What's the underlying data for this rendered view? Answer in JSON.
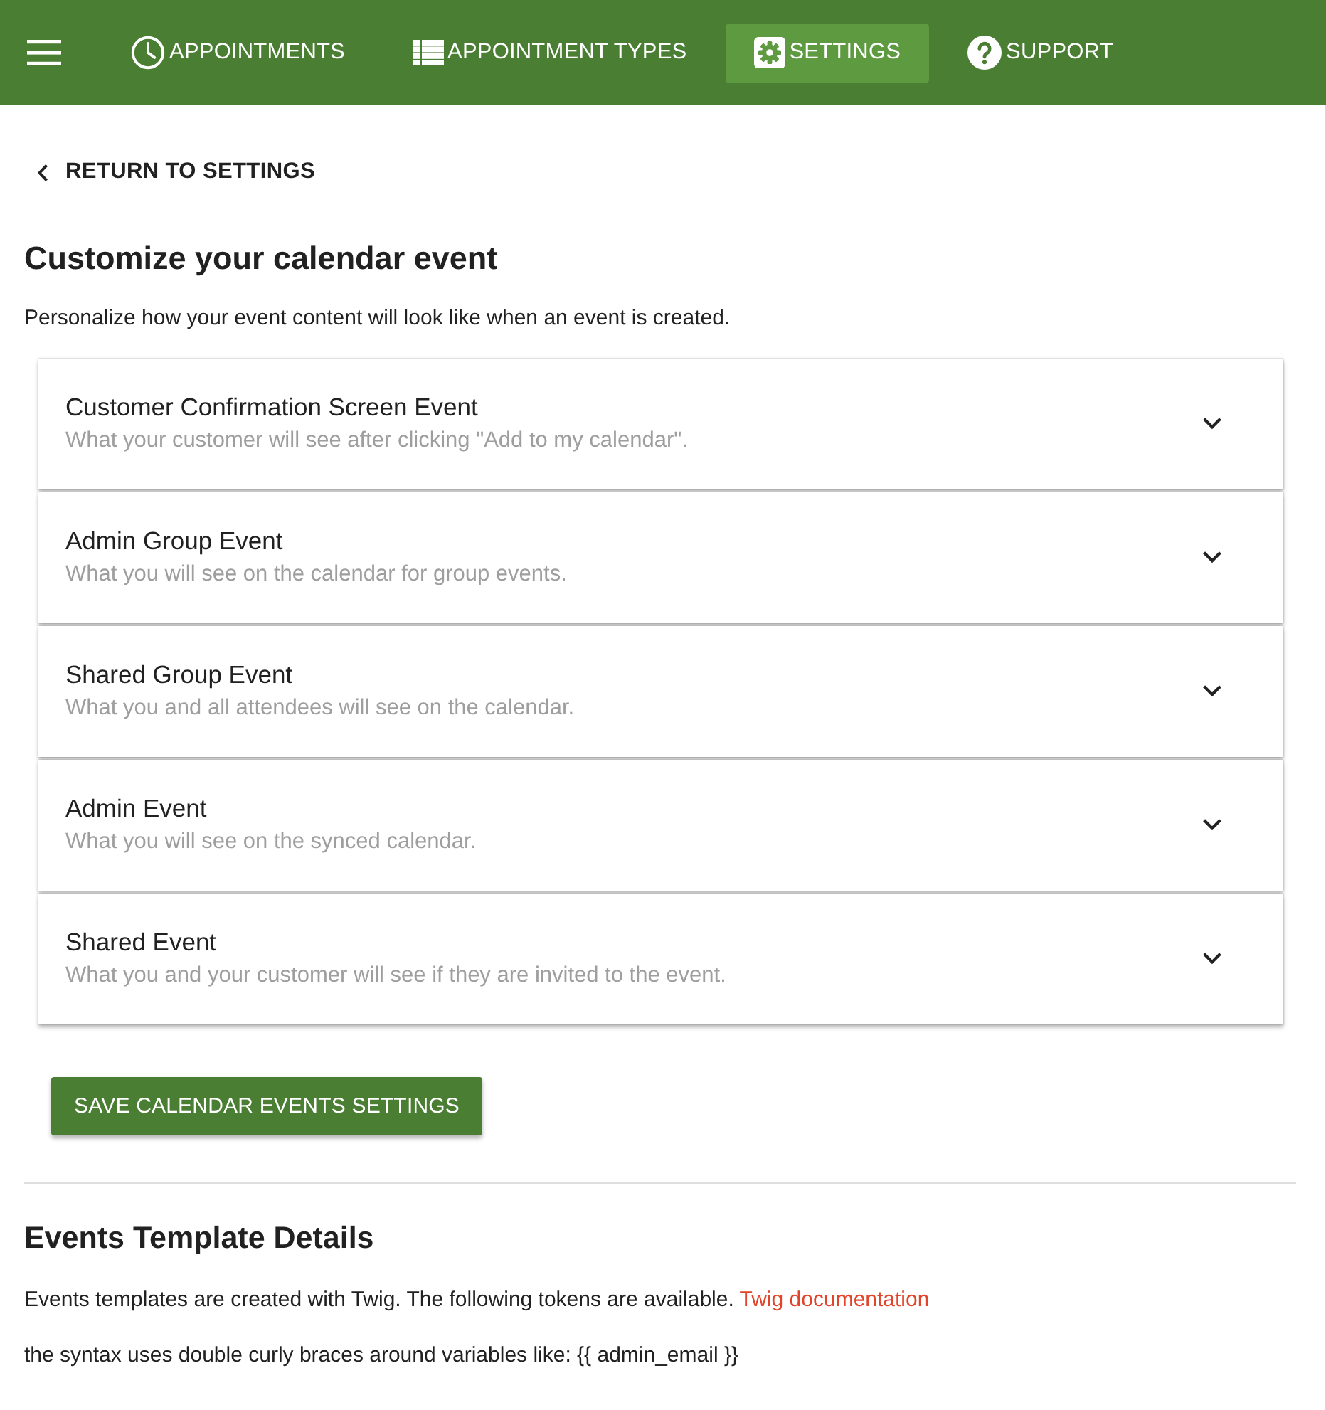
{
  "nav": {
    "tabs": [
      {
        "kind": "clock",
        "label": "APPOINTMENTS",
        "selected": false
      },
      {
        "kind": "list",
        "label": "APPOINTMENT TYPES",
        "selected": false
      },
      {
        "kind": "gear",
        "label": "SETTINGS",
        "selected": true
      },
      {
        "kind": "help",
        "label": "SUPPORT",
        "selected": false
      }
    ]
  },
  "back_link": "RETURN TO SETTINGS",
  "heading": "Customize your calendar event",
  "intro": "Personalize how your event content will look like when an event is created.",
  "panels": [
    {
      "title": "Customer Confirmation Screen Event",
      "subtitle": "What your customer will see after clicking \"Add to my calendar\".",
      "expanded": false
    },
    {
      "title": "Admin Group Event",
      "subtitle": "What you will see on the calendar for group events.",
      "expanded": false
    },
    {
      "title": "Shared Group Event",
      "subtitle": "What you and all attendees will see on the calendar.",
      "expanded": false
    },
    {
      "title": "Admin Event",
      "subtitle": "What you will see on the synced calendar.",
      "expanded": false
    },
    {
      "title": "Shared Event",
      "subtitle": "What you and your customer will see if they are invited to the event.",
      "expanded": false
    }
  ],
  "save_button": "SAVE CALENDAR EVENTS SETTINGS",
  "details": {
    "heading": "Events Template Details",
    "text": "Events templates are created with Twig. The following tokens are available.",
    "link": "Twig documentation",
    "syntax_note": "the syntax uses double curly braces around variables like: {{ admin_email }}"
  }
}
